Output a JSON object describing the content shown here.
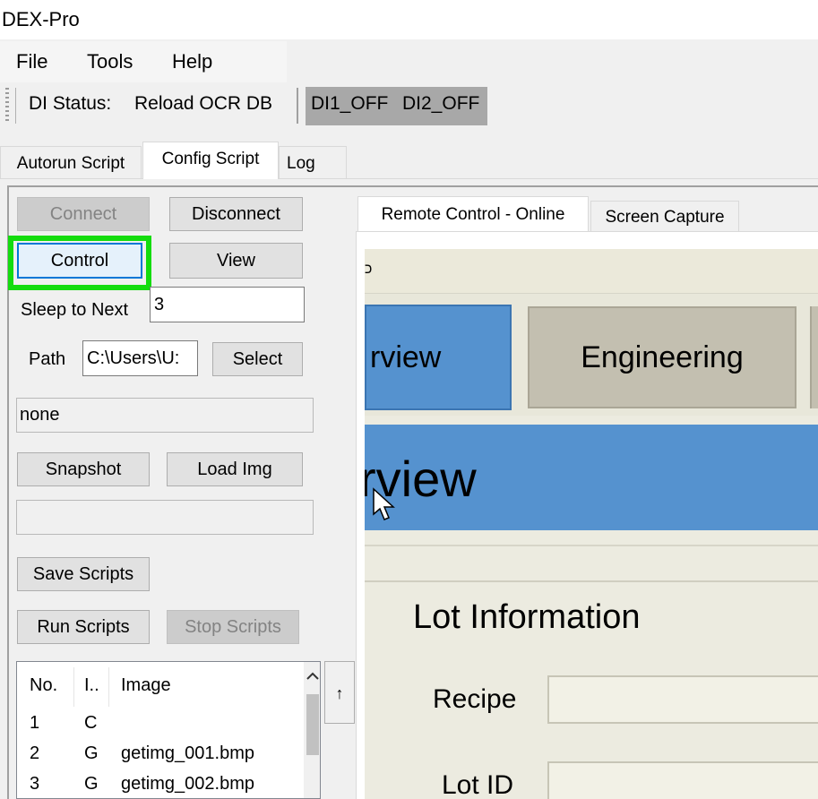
{
  "window": {
    "title": "DEX-Pro"
  },
  "menu": {
    "items": [
      "File",
      "Tools",
      "Help"
    ]
  },
  "toolbar": {
    "di_status_label": "DI Status:",
    "reload_label": "Reload OCR DB",
    "di1": "DI1_OFF",
    "di2": "DI2_OFF"
  },
  "main_tabs": [
    "Autorun Script",
    "Config Script",
    "Log"
  ],
  "left": {
    "connect": "Connect",
    "disconnect": "Disconnect",
    "control": "Control",
    "view": "View",
    "sleep_label": "Sleep to Next",
    "sleep_value": "3",
    "path_label": "Path",
    "path_value": "C:\\Users\\U:",
    "select": "Select",
    "status_value": "none",
    "snapshot": "Snapshot",
    "load_img": "Load Img",
    "save_scripts": "Save Scripts",
    "run_scripts": "Run Scripts",
    "stop_scripts": "Stop Scripts",
    "list": {
      "headers": [
        "No.",
        "I..",
        "Image"
      ],
      "rows": [
        [
          "1",
          "C",
          ""
        ],
        [
          "2",
          "G",
          "getimg_001.bmp"
        ],
        [
          "3",
          "G",
          "getimg_002.bmp"
        ]
      ]
    },
    "up_arrow": "↑"
  },
  "right_tabs": [
    "Remote Control - Online",
    "Screen Capture"
  ],
  "remote": {
    "strip_char": "כ",
    "overview_tab": "rview",
    "engineering_tab": "Engineering",
    "banner": "rview",
    "section_title": "Lot Information",
    "recipe_label": "Recipe",
    "lot_id_label": "Lot ID"
  },
  "colors": {
    "highlight": "#14dc0e",
    "remote_blue": "#5592cf",
    "remote_gray_btn": "#c3bfb0"
  }
}
